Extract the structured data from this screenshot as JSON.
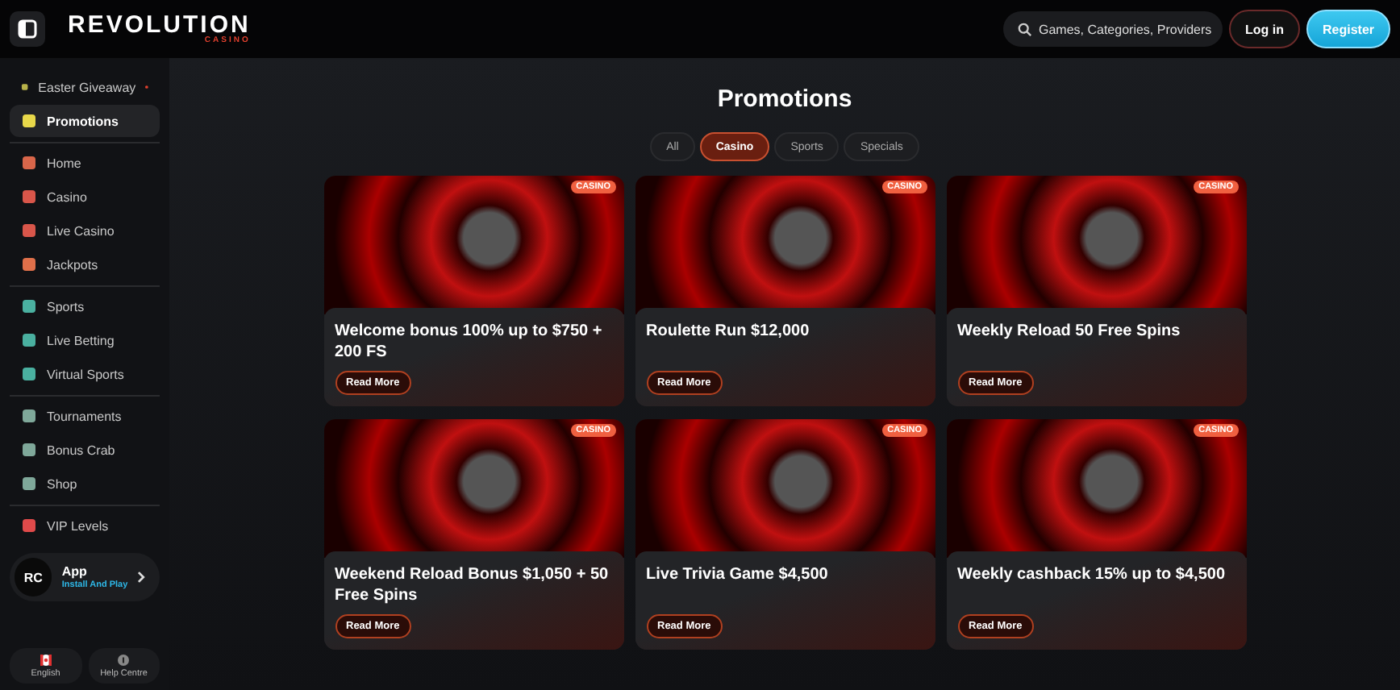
{
  "header": {
    "logo": {
      "name": "REVOLUTION",
      "sub": "CASINO"
    },
    "search": {
      "placeholder": "Games, Categories, Providers"
    },
    "buttons": [
      {
        "label": "Log in",
        "kind": "outline"
      },
      {
        "label": "Register",
        "kind": "primary"
      }
    ]
  },
  "sidebar": {
    "sections": [
      [
        {
          "label": "Easter Giveaway",
          "selected": false,
          "notification": true,
          "color": "#b8b24a"
        },
        {
          "label": "Promotions",
          "selected": true,
          "notification": false,
          "color": "#e8d84a"
        }
      ],
      [
        {
          "label": "Home",
          "selected": false,
          "notification": false,
          "color": "#d9664a"
        },
        {
          "label": "Casino",
          "selected": false,
          "notification": false,
          "color": "#d9564a"
        },
        {
          "label": "Live Casino",
          "selected": false,
          "notification": false,
          "color": "#d9564a"
        },
        {
          "label": "Jackpots",
          "selected": false,
          "notification": false,
          "color": "#e0704a"
        }
      ],
      [
        {
          "label": "Sports",
          "selected": false,
          "notification": false,
          "color": "#4ab0a0"
        },
        {
          "label": "Live Betting",
          "selected": false,
          "notification": false,
          "color": "#4ab0a0"
        },
        {
          "label": "Virtual Sports",
          "selected": false,
          "notification": false,
          "color": "#4ab0a0"
        }
      ],
      [
        {
          "label": "Tournaments",
          "selected": false,
          "notification": false,
          "color": "#7fa89a"
        },
        {
          "label": "Bonus Crab",
          "selected": false,
          "notification": false,
          "color": "#7fa89a"
        },
        {
          "label": "Shop",
          "selected": false,
          "notification": false,
          "color": "#7fa89a"
        }
      ],
      [
        {
          "label": "VIP Levels",
          "selected": false,
          "notification": false,
          "color": "#e04a4a"
        }
      ]
    ],
    "app": {
      "logo": "RC",
      "title": "App",
      "subtitle": "Install And Play"
    },
    "footer": [
      {
        "label": "English"
      },
      {
        "label": "Help Centre"
      }
    ]
  },
  "main": {
    "title": "Promotions",
    "tabs": [
      {
        "label": "All",
        "selected": false
      },
      {
        "label": "Casino",
        "selected": true
      },
      {
        "label": "Sports",
        "selected": false
      },
      {
        "label": "Specials",
        "selected": false
      }
    ],
    "cards": [
      {
        "title": "Welcome bonus 100% up to $750 + 200 FS",
        "badge": "CASINO",
        "button": "Read More"
      },
      {
        "title": "Roulette Run $12,000",
        "badge": "CASINO",
        "button": "Read More"
      },
      {
        "title": "Weekly Reload 50 Free Spins",
        "badge": "CASINO",
        "button": "Read More"
      },
      {
        "title": "Weekend Reload Bonus $1,050 + 50 Free Spins",
        "badge": "CASINO",
        "button": "Read More"
      },
      {
        "title": "Live Trivia Game $4,500",
        "badge": "CASINO",
        "button": "Read More"
      },
      {
        "title": "Weekly cashback 15% up to $4,500",
        "badge": "CASINO",
        "button": "Read More"
      }
    ]
  }
}
